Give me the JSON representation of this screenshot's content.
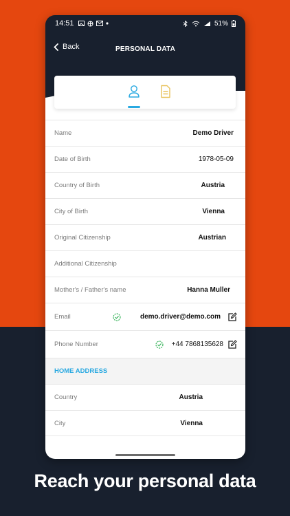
{
  "status_bar": {
    "time": "14:51",
    "battery": "51%"
  },
  "header": {
    "back_label": "Back",
    "title": "PERSONAL DATA"
  },
  "fields": [
    {
      "label": "Name",
      "value": "Demo Driver"
    },
    {
      "label": "Date of Birth",
      "value": "1978-05-09"
    },
    {
      "label": "Country of Birth",
      "value": "Austria"
    },
    {
      "label": "City of Birth",
      "value": "Vienna"
    },
    {
      "label": "Original Citizenship",
      "value": "Austrian"
    },
    {
      "label": "Additional Citizenship",
      "value": ""
    },
    {
      "label": "Mother's / Father's name",
      "value": "Hanna Muller"
    }
  ],
  "contact": {
    "email": {
      "label": "Email",
      "value": "demo.driver@demo.com"
    },
    "phone": {
      "label": "Phone Number",
      "value": "+44 7868135628"
    }
  },
  "home_address": {
    "heading": "HOME ADDRESS",
    "fields": [
      {
        "label": "Country",
        "value": "Austria"
      },
      {
        "label": "City",
        "value": "Vienna"
      }
    ]
  },
  "caption": "Reach your personal data",
  "colors": {
    "accent": "#29a9e1",
    "orange": "#e5470f",
    "navy": "#18202e",
    "verified": "#3cb55e",
    "document_tab": "#e8c25a"
  }
}
